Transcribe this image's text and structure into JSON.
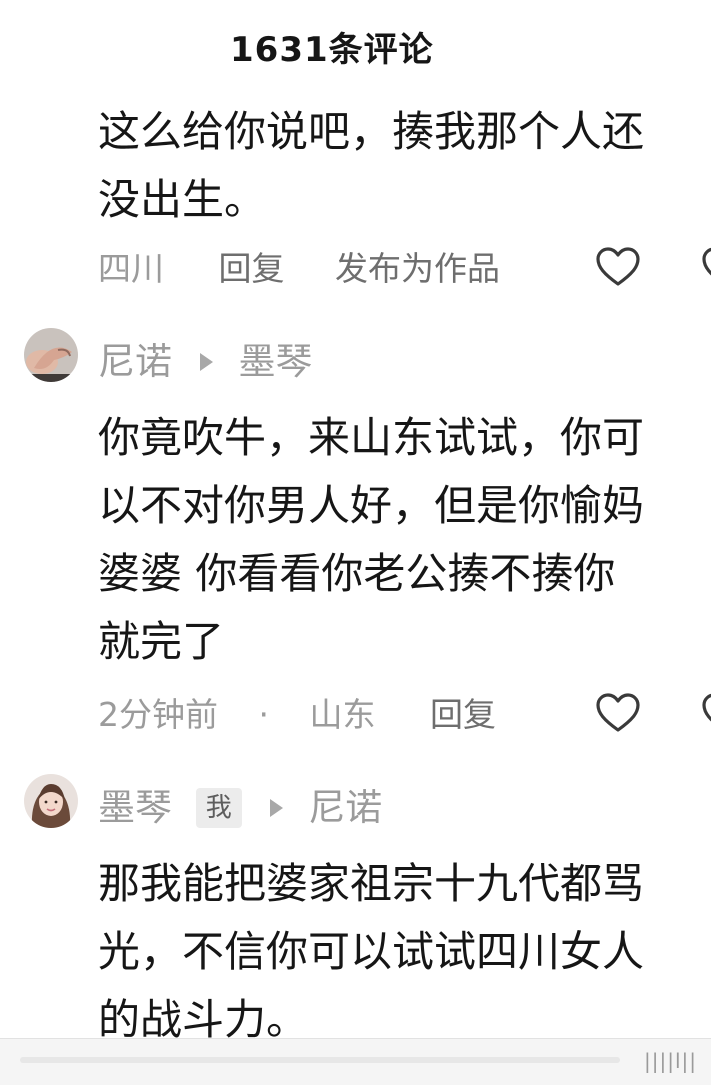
{
  "header": {
    "title": "1631条评论"
  },
  "comments": [
    {
      "text_lines": [
        "这么给你说吧，揍我那个人还",
        "没出生。"
      ],
      "meta": {
        "location": "四川",
        "reply": "回复",
        "publish": "发布为作品"
      }
    },
    {
      "author": "尼诺",
      "reply_to": "墨琴",
      "avatar": "hand-avatar",
      "text_lines": [
        "你竟吹牛，来山东试试，你可",
        "以不对你男人好，但是你愉妈",
        "婆婆 你看看你老公揍不揍你",
        "就完了"
      ],
      "meta": {
        "time": "2分钟前",
        "dot": "·",
        "location": "山东",
        "reply": "回复"
      }
    },
    {
      "author": "墨琴",
      "author_tag": "我",
      "reply_to": "尼诺",
      "avatar": "woman-avatar",
      "text_lines": [
        "那我能把婆家祖宗十九代都骂",
        "光，不信你可以试试四川女人",
        "的战斗力。"
      ]
    }
  ],
  "bottom_bar": {
    "progress": 0.0,
    "watermark": "||||l||"
  },
  "colors": {
    "text": "#161616",
    "meta": "#9b9b9b",
    "reply": "#6e6e6e"
  }
}
